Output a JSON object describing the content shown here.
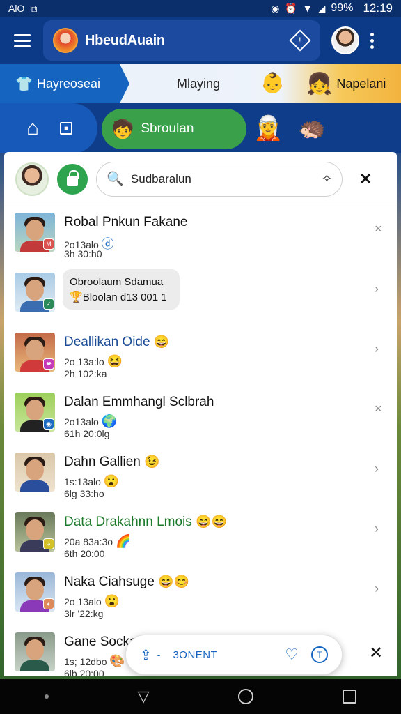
{
  "status_bar": {
    "left_icons": [
      "AlO",
      "⧉"
    ],
    "battery": "99%",
    "time": "12:19"
  },
  "app_bar": {
    "title": "HbeudAuain"
  },
  "tabs": {
    "active": "Hayreoseai",
    "middle": "Mlaying",
    "right": "Napelani"
  },
  "nav": {
    "green_label": "Sbroulan"
  },
  "search": {
    "value": "Sudbaralun",
    "placeholder": "Sudbaralun"
  },
  "contacts": [
    {
      "name": "Robal Pnkun Fakane",
      "line1": "2o13alo",
      "line1_emoji": "ⓓ",
      "line2": "3h 30:h0",
      "badge": "M",
      "badge_color": "#d9534f",
      "name_style": "",
      "chev": "×"
    },
    {
      "bubble_line1": "Obroolaum Sdamua",
      "bubble_line2": "Bloolan d13 001 1",
      "badge": "✓",
      "badge_color": "#2a8a5a",
      "chev": "›"
    },
    {
      "name": "Deallikan Oide",
      "name_emoji": "😄",
      "line1": "2o 13a:lo",
      "line1_emoji": "😆",
      "line2": "2h 102:ka",
      "badge": "❤",
      "badge_color": "#c43ab8",
      "name_style": "blue",
      "chev": "›"
    },
    {
      "name": "Dalan Emmhangl Sclbrah",
      "line1": "2o13alo",
      "line1_emoji": "🌍",
      "line2": "61h 20:0lg",
      "badge": "◉",
      "badge_color": "#1e6cc2",
      "name_style": "",
      "chev": "×"
    },
    {
      "name": "Dahn Gallien",
      "name_emoji": "😉",
      "line1": "1s:13alo",
      "line1_emoji": "😮",
      "line2": "6lg 33:ho",
      "badge": "",
      "badge_color": "",
      "name_style": "",
      "chev": "›"
    },
    {
      "name": "Data Drakahnn Lmois",
      "name_emoji": "😄😄",
      "line1": "20a 83a:3o",
      "line1_emoji": "🌈",
      "line2": "6th 20:00",
      "badge": "◕",
      "badge_color": "#d4c02a",
      "name_style": "green",
      "chev": "›"
    },
    {
      "name": "Naka Ciahsuge",
      "name_emoji": "😄😊",
      "line1": "2o 13alo",
      "line1_emoji": "😮",
      "line2": "3lr '22:kg",
      "badge": "◐",
      "badge_color": "#e08a5a",
      "name_style": "",
      "chev": "›"
    },
    {
      "name": "Gane Sockan Temain",
      "name_emoji": "😄",
      "line1": "1s; 12dbo",
      "line1_emoji": "🎨",
      "line2": "6lb 20:00",
      "badge": "",
      "badge_color": "",
      "name_style": "",
      "chev": ""
    }
  ],
  "float_bar": {
    "label": "3ONENT",
    "dash": "-"
  }
}
